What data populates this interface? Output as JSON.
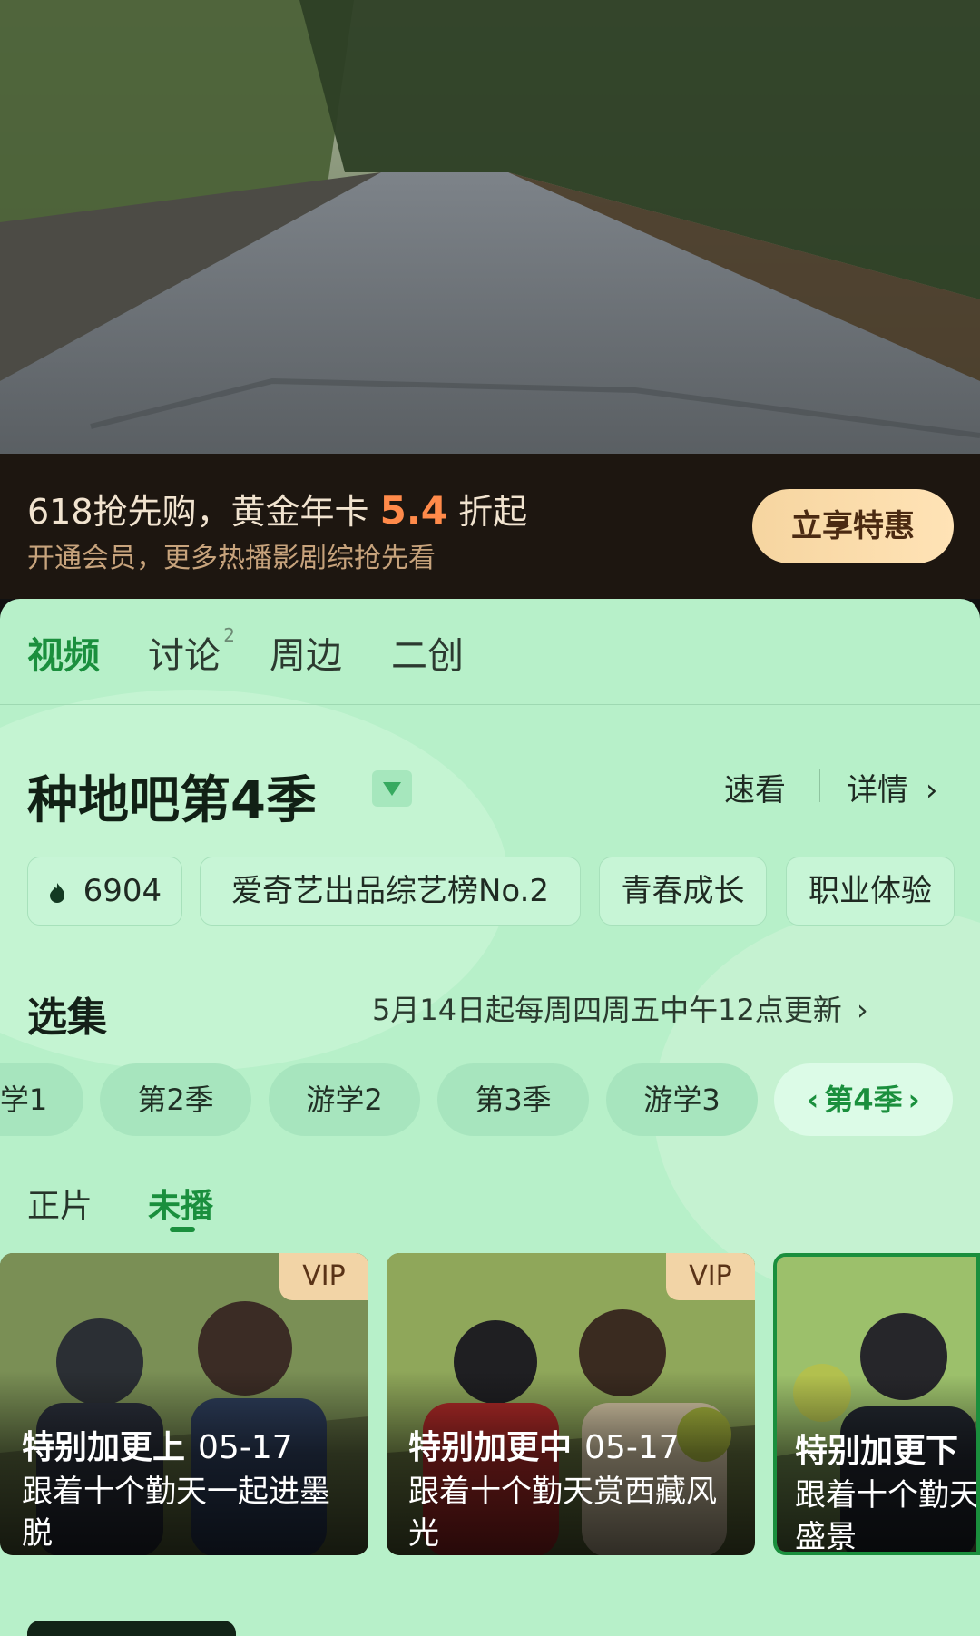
{
  "promo": {
    "line1_prefix": "618抢先购，黄金年卡 ",
    "line1_highlight": "5.4",
    "line1_suffix": " 折起",
    "line2": "开通会员，更多热播影剧综抢先看",
    "cta": "立享特惠"
  },
  "tabs": [
    {
      "label": "视频"
    },
    {
      "label": "讨论",
      "badge": "2"
    },
    {
      "label": "周边"
    },
    {
      "label": "二创"
    }
  ],
  "show": {
    "title": "种地吧第4季",
    "links": {
      "quick": "速看",
      "details": "详情"
    }
  },
  "chips": {
    "heat": "6904",
    "rank": "爱奇艺出品综艺榜No.2",
    "tag1": "青春成长",
    "tag2": "职业体验"
  },
  "episodes": {
    "title": "选集",
    "schedule": "5月14日起每周四周五中午12点更新",
    "seasons": [
      "学1",
      "第2季",
      "游学2",
      "第3季",
      "游学3",
      "第4季"
    ],
    "sub_tabs": [
      "正片",
      "未播"
    ]
  },
  "cards": [
    {
      "vip": "VIP",
      "title": "特别加更上",
      "date": "05-17",
      "desc": "跟着十个勤天一起进墨脱"
    },
    {
      "vip": "VIP",
      "title": "特别加更中",
      "date": "05-17",
      "desc": "跟着十个勤天赏西藏风光"
    },
    {
      "title": "特别加更下",
      "desc": "跟着十个勤天盛景"
    }
  ]
}
